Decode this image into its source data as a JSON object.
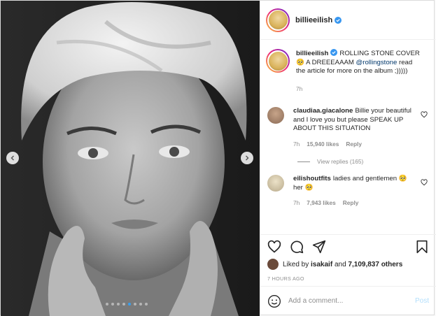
{
  "post": {
    "username": "billieeilish",
    "caption_user": "billieeilish",
    "caption_text": "ROLLING STONE COVER 🥺 A DREEEAAAM",
    "caption_mention": "@rollingstone",
    "caption_rest": "read the article for more on the album ;)))))",
    "caption_time": "7h",
    "carousel_count": 8,
    "carousel_active": 4
  },
  "comments": [
    {
      "user": "claudiaa.giacalone",
      "text": "Billie your beautiful and I love you but please SPEAK UP ABOUT THIS SITUATION",
      "time": "7h",
      "likes": "15,940 likes",
      "reply": "Reply",
      "view_replies": "View replies (165)"
    },
    {
      "user": "eilishoutfits",
      "text": "ladies and gentlemen 🥺 her 🥺",
      "time": "7h",
      "likes": "7,943 likes",
      "reply": "Reply"
    }
  ],
  "engagement": {
    "liked_by_prefix": "Liked by",
    "liked_by_user": "isakaif",
    "liked_by_and": "and",
    "liked_by_count": "7,109,837 others",
    "time_ago": "7 HOURS AGO"
  },
  "composer": {
    "placeholder": "Add a comment...",
    "post_label": "Post"
  },
  "icons": [
    "chevron-left-icon",
    "chevron-right-icon",
    "verified-icon",
    "heart-icon",
    "comment-icon",
    "share-icon",
    "bookmark-icon",
    "emoji-icon"
  ],
  "colors": {
    "verified": "#3897f0",
    "link": "#00376b",
    "muted": "#8e8e8e",
    "post_disabled": "#b2dffc",
    "carousel_active": "#38a0f0"
  }
}
